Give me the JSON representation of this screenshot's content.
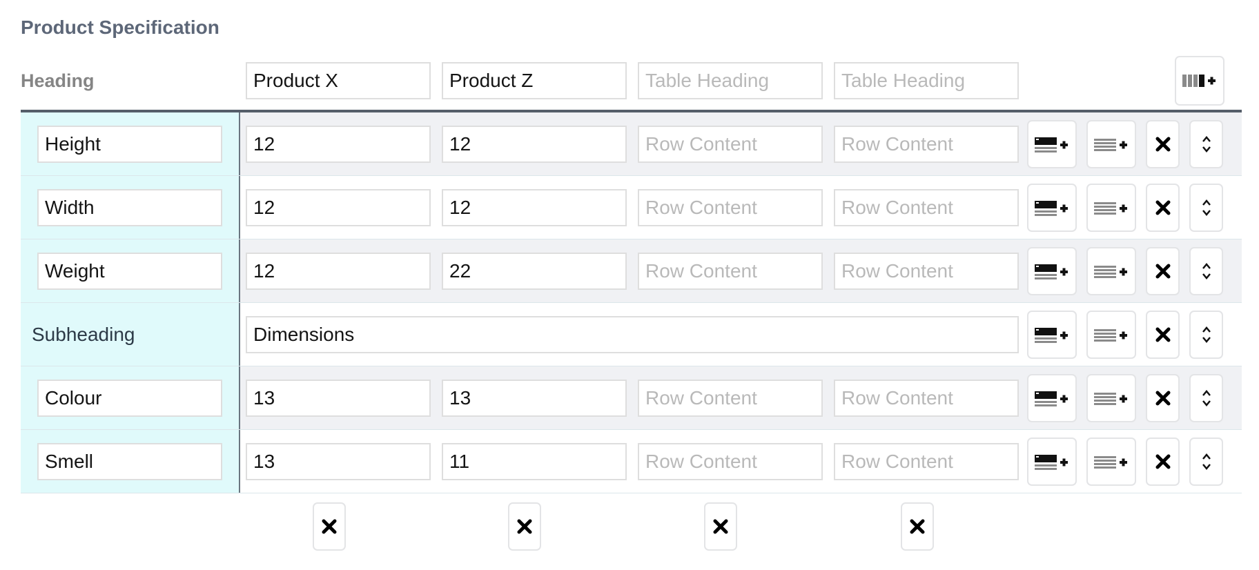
{
  "section_title": "Product Specification",
  "header": {
    "label": "Heading",
    "columns": [
      {
        "value": "Product X",
        "placeholder": "Table Heading"
      },
      {
        "value": "Product Z",
        "placeholder": "Table Heading"
      },
      {
        "value": "",
        "placeholder": "Table Heading"
      },
      {
        "value": "",
        "placeholder": "Table Heading"
      }
    ]
  },
  "cell_placeholder": "Row Content",
  "rows": [
    {
      "type": "row",
      "label": "Height",
      "cells": [
        "12",
        "12",
        "",
        ""
      ]
    },
    {
      "type": "row",
      "label": "Width",
      "cells": [
        "12",
        "12",
        "",
        ""
      ]
    },
    {
      "type": "row",
      "label": "Weight",
      "cells": [
        "12",
        "22",
        "",
        ""
      ]
    },
    {
      "type": "subheading",
      "label": "Subheading",
      "value": "Dimensions"
    },
    {
      "type": "row",
      "label": "Colour",
      "cells": [
        "13",
        "13",
        "",
        ""
      ]
    },
    {
      "type": "row",
      "label": "Smell",
      "cells": [
        "13",
        "11",
        "",
        ""
      ]
    }
  ],
  "icons": {
    "add_column": "add-column-icon",
    "add_subheading": "add-subheading-icon",
    "add_row": "add-row-icon",
    "delete": "close-icon",
    "move": "sort-icon"
  },
  "colors": {
    "label_bg": "#e0fafb",
    "shade_row": "#f0f1f4",
    "title": "#5d6778",
    "divider": "#555e69"
  }
}
